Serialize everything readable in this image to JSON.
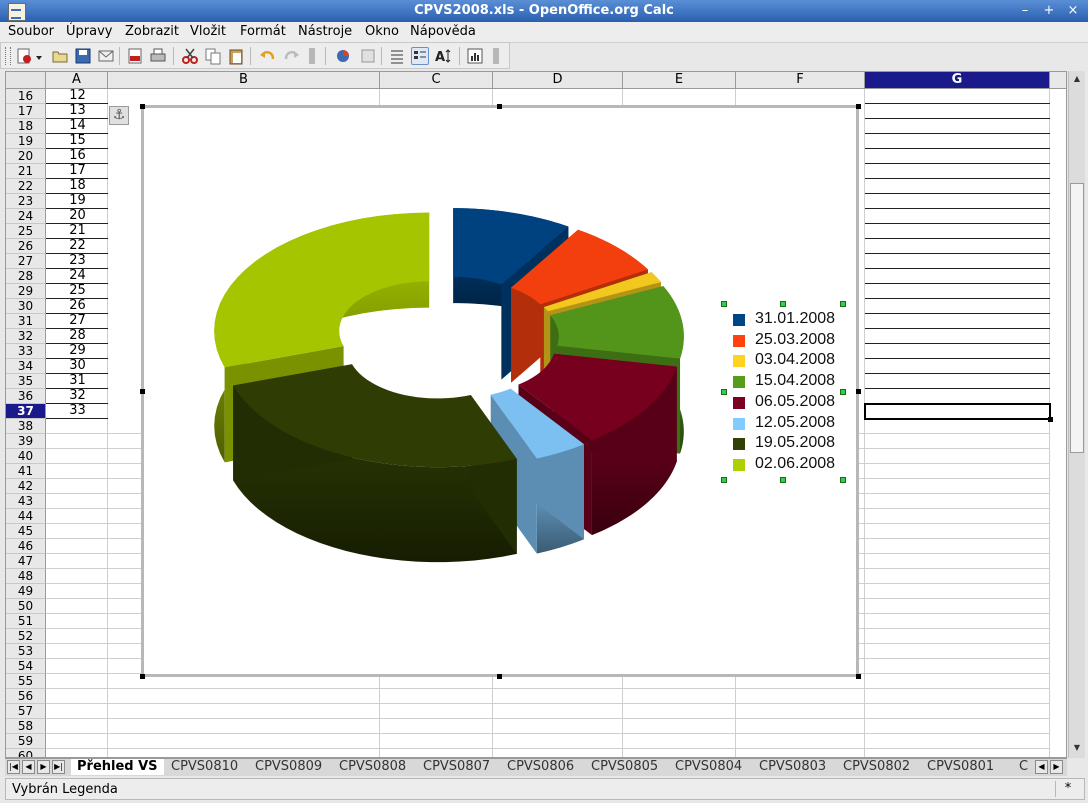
{
  "window": {
    "title": "CPVS2008.xls - OpenOffice.org Calc"
  },
  "menu": [
    "Soubor",
    "Úpravy",
    "Zobrazit",
    "Vložit",
    "Formát",
    "Nástroje",
    "Okno",
    "Nápověda"
  ],
  "toolbar": {
    "buttons": [
      "new-document-icon",
      "open-icon",
      "save-icon",
      "email-icon",
      "export-pdf-icon",
      "print-icon",
      "cut-icon",
      "copy-icon",
      "paste-icon",
      "undo-icon",
      "redo-icon",
      "chart-data-table-icon",
      "chart-type-icon",
      "chart-insert-icon",
      "horizontal-grid-icon",
      "legend-toggle-icon",
      "scale-text-icon",
      "chart-autoformat-icon"
    ]
  },
  "columns": [
    "A",
    "B",
    "C",
    "D",
    "E",
    "F",
    "G"
  ],
  "active_column": "G",
  "rows": [
    16,
    17,
    18,
    19,
    20,
    21,
    22,
    23,
    24,
    25,
    26,
    27,
    28,
    29,
    30,
    31,
    32,
    33,
    34,
    35,
    36,
    37,
    38,
    39,
    40,
    41,
    42,
    43,
    44,
    45,
    46,
    47,
    48,
    49,
    50,
    51,
    52,
    53,
    54,
    55,
    56,
    57,
    58,
    59,
    60
  ],
  "active_row": 37,
  "col_a_values": [
    "12",
    "13",
    "14",
    "15",
    "16",
    "17",
    "18",
    "19",
    "20",
    "21",
    "22",
    "23",
    "24",
    "25",
    "26",
    "27",
    "28",
    "29",
    "30",
    "31",
    "32",
    "33"
  ],
  "chart_data": {
    "type": "pie",
    "variant": "3d-donut-exploded",
    "categories": [
      "31.01.2008",
      "25.03.2008",
      "03.04.2008",
      "15.04.2008",
      "06.05.2008",
      "12.05.2008",
      "19.05.2008",
      "02.06.2008"
    ],
    "values": [
      9,
      7.5,
      1.5,
      10,
      12,
      4,
      26,
      30
    ],
    "colors": [
      "#004586",
      "#ff420e",
      "#ffd320",
      "#579d1c",
      "#7e0021",
      "#83caff",
      "#314004",
      "#aecf00"
    ],
    "legend_position": "right"
  },
  "sheet_tabs": [
    "Přehled VS",
    "CPVS0810",
    "CPVS0809",
    "CPVS0808",
    "CPVS0807",
    "CPVS0806",
    "CPVS0805",
    "CPVS0804",
    "CPVS0803",
    "CPVS0802",
    "CPVS0801",
    "C"
  ],
  "active_tab": "Přehled VS",
  "status": {
    "text": "Vybrán Legenda",
    "modified_indicator": "*"
  }
}
